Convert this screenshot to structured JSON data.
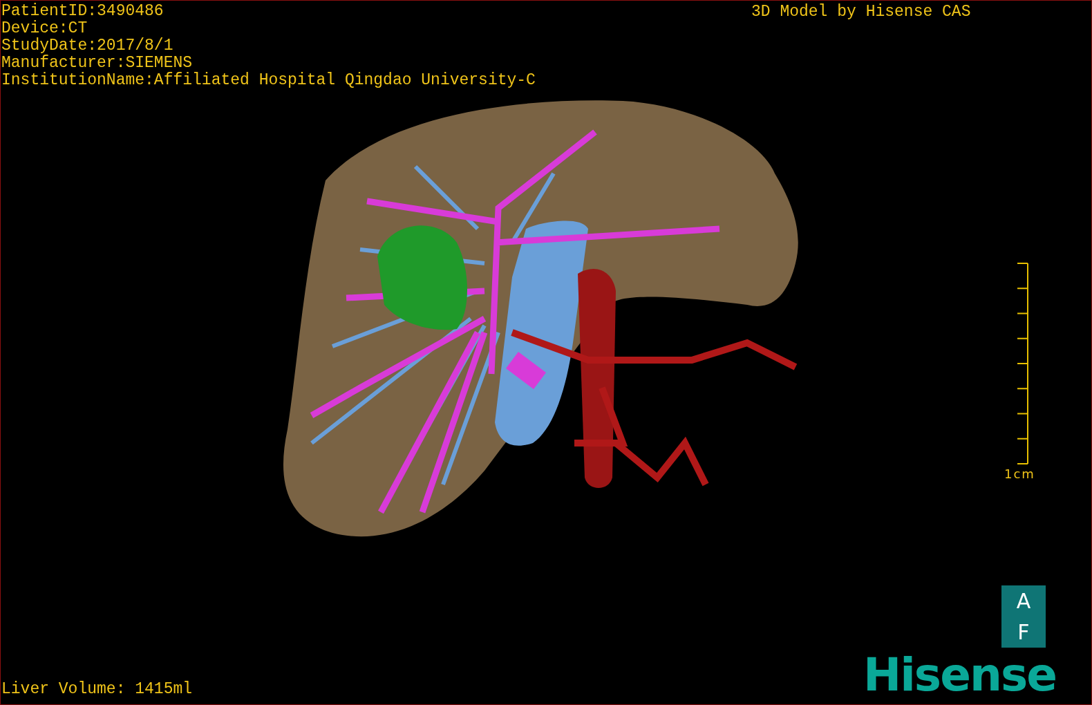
{
  "info_lines": [
    "PatientID:3490486",
    "Device:CT",
    "StudyDate:2017/8/1",
    "Manufacturer:SIEMENS",
    "InstitutionName:Affiliated Hospital Qingdao University-C"
  ],
  "model_credit": "3D Model by Hisense CAS",
  "scale_bar": {
    "label": "1cm"
  },
  "orientation_cube": {
    "top": "A",
    "bottom": "F"
  },
  "liver_volume": "Liver Volume: 1415ml",
  "brand_logo": "Hisense"
}
